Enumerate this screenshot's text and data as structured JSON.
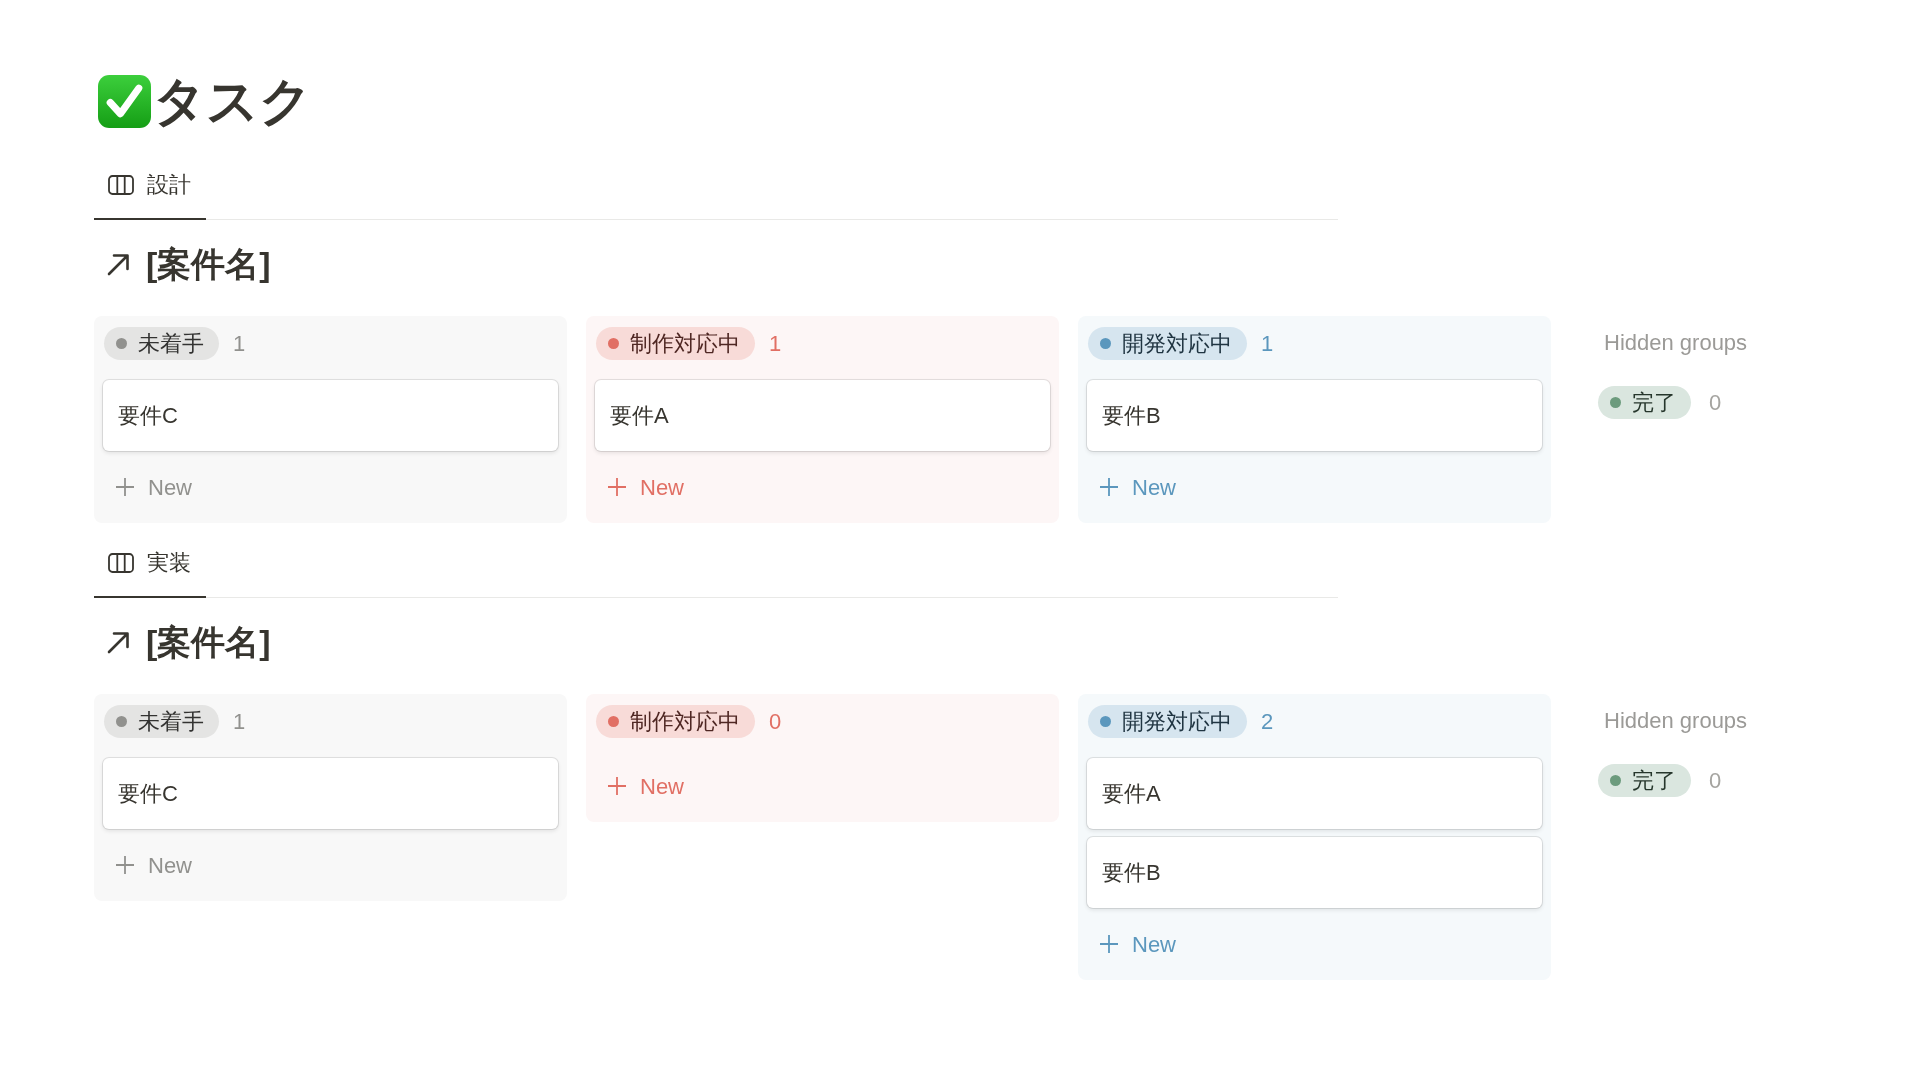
{
  "page": {
    "title": "タスク"
  },
  "views": [
    {
      "tab": {
        "label": "設計",
        "selected": true
      },
      "database": {
        "title": "[案件名]"
      },
      "groups": [
        {
          "label": "未着手",
          "color": "#91918e",
          "count": "1",
          "cards": [
            {
              "title": "要件C"
            }
          ],
          "new_label": "New"
        },
        {
          "label": "制作対応中",
          "color": "#e16f64",
          "count": "1",
          "cards": [
            {
              "title": "要件A"
            }
          ],
          "new_label": "New"
        },
        {
          "label": "開発対応中",
          "color": "#5b97bd",
          "count": "1",
          "cards": [
            {
              "title": "要件B"
            }
          ],
          "new_label": "New"
        }
      ],
      "hidden_groups": {
        "title": "Hidden groups",
        "groups": [
          {
            "label": "完了",
            "color": "#6c9b7d",
            "count": "0"
          }
        ]
      }
    },
    {
      "tab": {
        "label": "実装",
        "selected": true
      },
      "database": {
        "title": "[案件名]"
      },
      "groups": [
        {
          "label": "未着手",
          "color": "#91918e",
          "count": "1",
          "cards": [
            {
              "title": "要件C"
            }
          ],
          "new_label": "New"
        },
        {
          "label": "制作対応中",
          "color": "#e16f64",
          "count": "0",
          "new_label": "New"
        },
        {
          "label": "開発対応中",
          "color": "#5b97bd",
          "count": "2",
          "cards": [
            {
              "title": "要件A"
            },
            {
              "title": "要件B"
            }
          ],
          "new_label": "New"
        }
      ],
      "hidden_groups": {
        "title": "Hidden groups",
        "groups": [
          {
            "label": "完了",
            "color": "#6c9b7d",
            "count": "0"
          }
        ]
      }
    }
  ]
}
